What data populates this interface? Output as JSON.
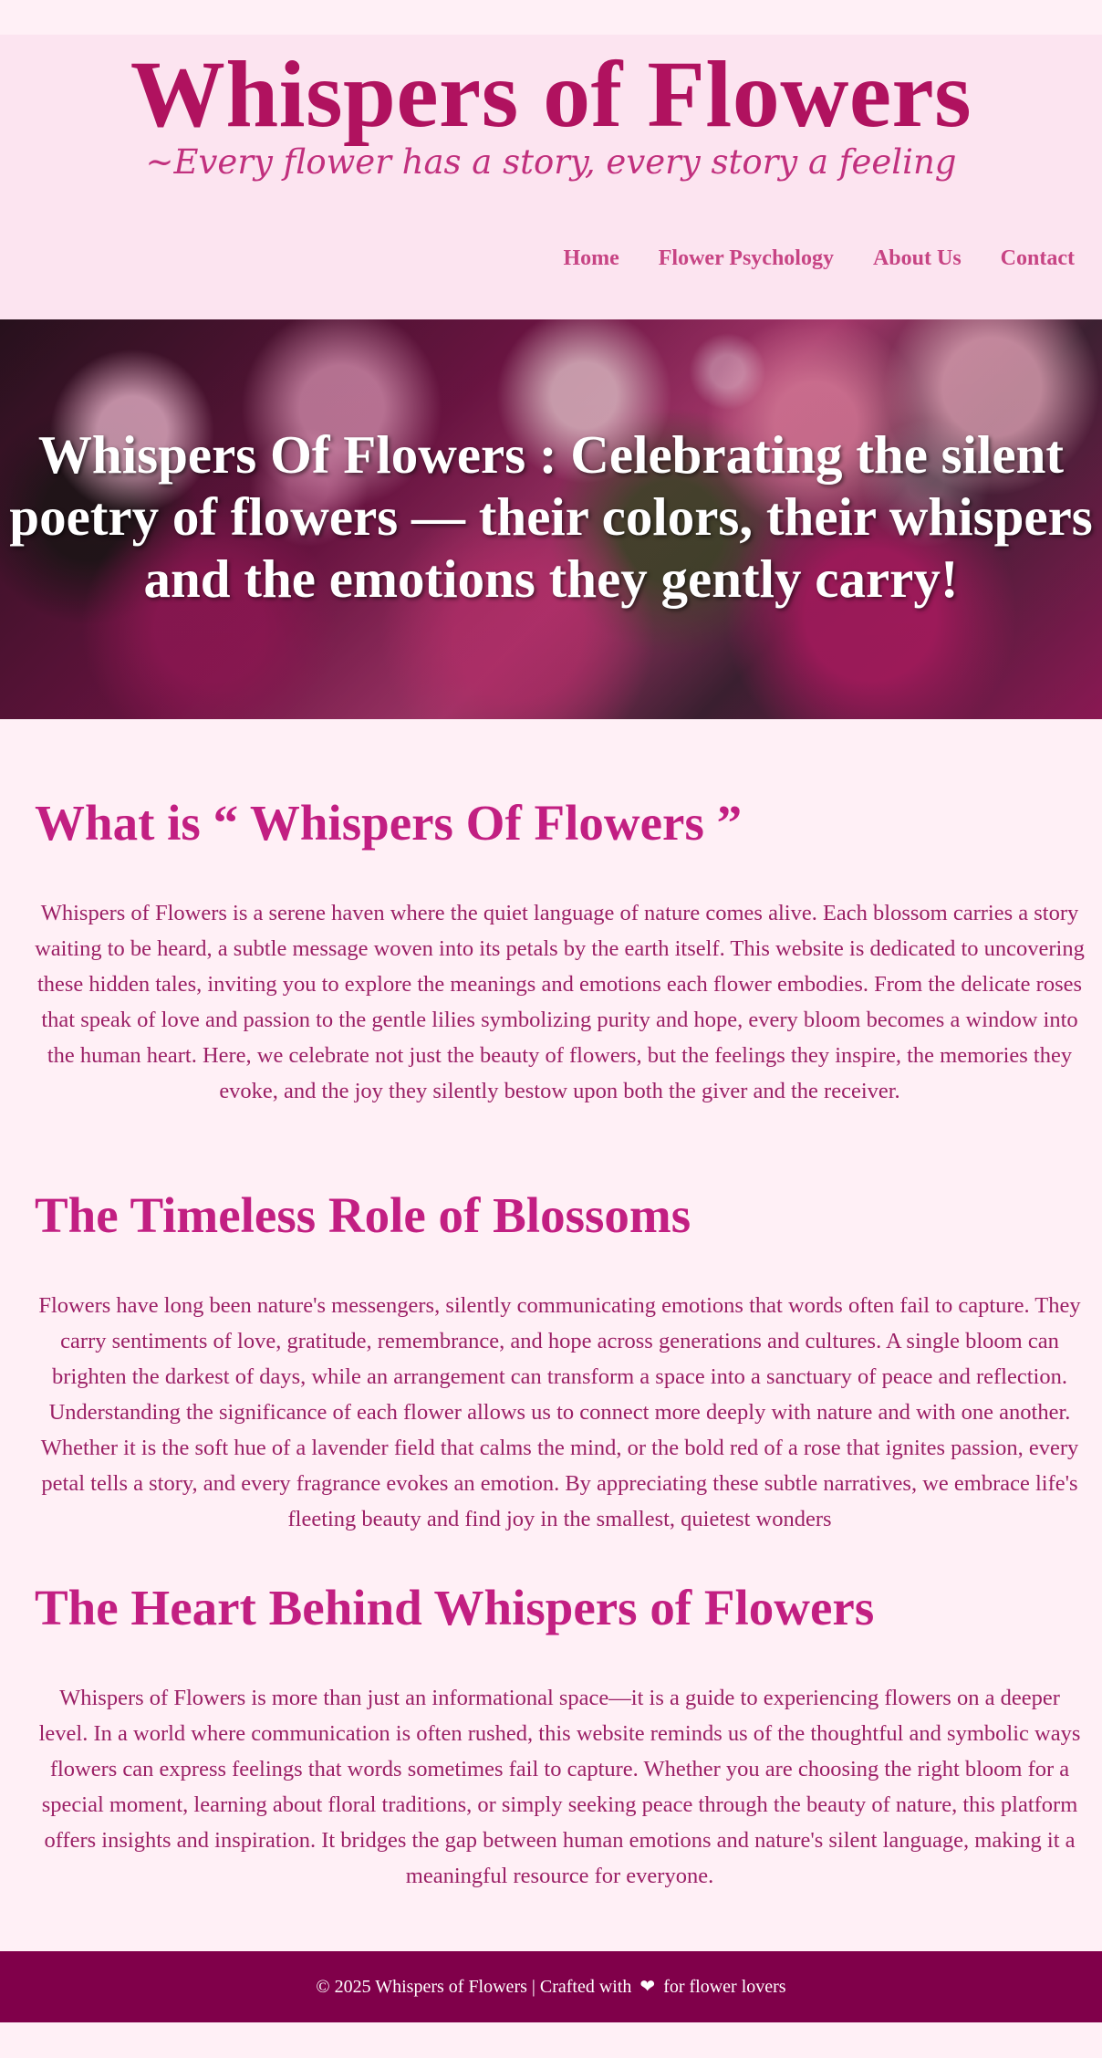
{
  "header": {
    "title": "Whispers of Flowers",
    "tagline": "~Every flower has a story, every story a feeling"
  },
  "nav": {
    "items": [
      {
        "label": "Home"
      },
      {
        "label": "Flower Psychology"
      },
      {
        "label": "About Us"
      },
      {
        "label": "Contact"
      }
    ]
  },
  "hero": {
    "title": "Whispers Of Flowers : Celebrating the silent poetry of flowers — their colors, their whispers and the emotions they gently carry!"
  },
  "sections": [
    {
      "title": "What is “ Whispers Of Flowers ”",
      "text": "Whispers of Flowers is a serene haven where the quiet language of nature comes alive. Each blossom carries a story waiting to be heard, a subtle message woven into its petals by the earth itself. This website is dedicated to uncovering these hidden tales, inviting you to explore the meanings and emotions each flower embodies. From the delicate roses that speak of love and passion to the gentle lilies symbolizing purity and hope, every bloom becomes a window into the human heart. Here, we celebrate not just the beauty of flowers, but the feelings they inspire, the memories they evoke, and the joy they silently bestow upon both the giver and the receiver."
    },
    {
      "title": "The Timeless Role of Blossoms",
      "text": "Flowers have long been nature's messengers, silently communicating emotions that words often fail to capture. They carry sentiments of love, gratitude, remembrance, and hope across generations and cultures. A single bloom can brighten the darkest of days, while an arrangement can transform a space into a sanctuary of peace and reflection. Understanding the significance of each flower allows us to connect more deeply with nature and with one another. Whether it is the soft hue of a lavender field that calms the mind, or the bold red of a rose that ignites passion, every petal tells a story, and every fragrance evokes an emotion. By appreciating these subtle narratives, we embrace life's fleeting beauty and find joy in the smallest, quietest wonders"
    },
    {
      "title": "The Heart Behind Whispers of Flowers",
      "text": "Whispers of Flowers is more than just an informational space—it is a guide to experiencing flowers on a deeper level. In a world where communication is often rushed, this website reminds us of the thoughtful and symbolic ways flowers can express feelings that words sometimes fail to capture. Whether you are choosing the right bloom for a special moment, learning about floral traditions, or simply seeking peace through the beauty of nature, this platform offers insights and inspiration. It bridges the gap between human emotions and nature's silent language, making it a meaningful resource for everyone."
    }
  ],
  "footer": {
    "before_heart": "© 2025 Whispers of Flowers | Crafted with",
    "heart": "❤",
    "after_heart": "for flower lovers"
  },
  "colors": {
    "page_background": "#fff0f6",
    "header_background": "#fce4f0",
    "accent": "#b0125f",
    "heading": "#c21f82",
    "body_text": "#9b2066",
    "footer_background": "#80004a"
  }
}
